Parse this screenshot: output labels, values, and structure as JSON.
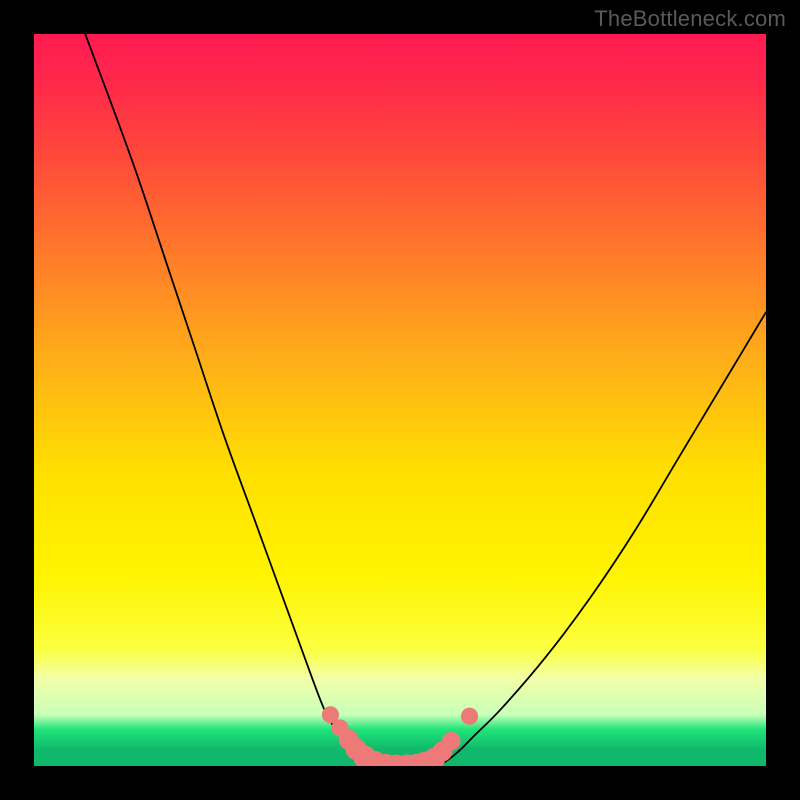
{
  "watermark": "TheBottleneck.com",
  "colors": {
    "frame": "#000000",
    "marker": "#ed7a78",
    "curve": "#000000"
  },
  "chart_data": {
    "type": "line",
    "title": "",
    "xlabel": "",
    "ylabel": "",
    "xlim": [
      0,
      100
    ],
    "ylim": [
      0,
      100
    ],
    "grid": false,
    "legend": false,
    "series": [
      {
        "name": "left-curve",
        "x": [
          7,
          10,
          14,
          18,
          22,
          26,
          30,
          34,
          38,
          40,
          42,
          44,
          46,
          48
        ],
        "y": [
          100,
          92,
          81,
          69,
          57,
          45,
          34,
          23,
          12,
          7,
          4,
          2,
          0.5,
          0
        ]
      },
      {
        "name": "right-curve",
        "x": [
          54,
          56,
          58,
          60,
          64,
          70,
          76,
          82,
          88,
          94,
          100
        ],
        "y": [
          0,
          0.5,
          2,
          4,
          8,
          15,
          23,
          32,
          42,
          52,
          62
        ]
      }
    ],
    "markers": {
      "name": "bottom-salmon-markers",
      "color": "#ed7a78",
      "points": [
        {
          "x": 40.5,
          "y": 7.0,
          "r": 1.1
        },
        {
          "x": 41.8,
          "y": 5.2,
          "r": 1.1
        },
        {
          "x": 43.0,
          "y": 3.6,
          "r": 1.3
        },
        {
          "x": 44.0,
          "y": 2.3,
          "r": 1.4
        },
        {
          "x": 45.2,
          "y": 1.2,
          "r": 1.5
        },
        {
          "x": 46.5,
          "y": 0.5,
          "r": 1.5
        },
        {
          "x": 48.0,
          "y": 0.1,
          "r": 1.5
        },
        {
          "x": 49.5,
          "y": 0.0,
          "r": 1.5
        },
        {
          "x": 51.0,
          "y": 0.0,
          "r": 1.5
        },
        {
          "x": 52.3,
          "y": 0.1,
          "r": 1.5
        },
        {
          "x": 53.5,
          "y": 0.4,
          "r": 1.5
        },
        {
          "x": 54.7,
          "y": 1.0,
          "r": 1.4
        },
        {
          "x": 55.8,
          "y": 2.0,
          "r": 1.3
        },
        {
          "x": 57.0,
          "y": 3.4,
          "r": 1.2
        },
        {
          "x": 59.5,
          "y": 6.8,
          "r": 1.1
        }
      ]
    }
  }
}
